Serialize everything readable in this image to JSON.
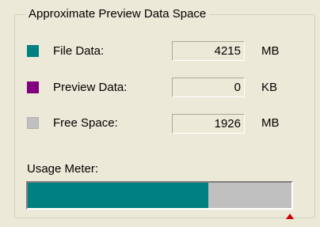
{
  "group": {
    "title": "Approximate Preview Data Space"
  },
  "rows": [
    {
      "label": "File Data:",
      "value": "4215",
      "unit": "MB",
      "color": "#008080"
    },
    {
      "label": "Preview Data:",
      "value": "0",
      "unit": "KB",
      "color": "#800080"
    },
    {
      "label": "Free Space:",
      "value": "1926",
      "unit": "MB",
      "color": "#c0c0c0"
    }
  ],
  "meter": {
    "label": "Usage Meter:",
    "fill_fraction": 0.685,
    "fill_color": "#008080",
    "background_color": "#c0c0c0",
    "marker_color": "#cc0000"
  }
}
